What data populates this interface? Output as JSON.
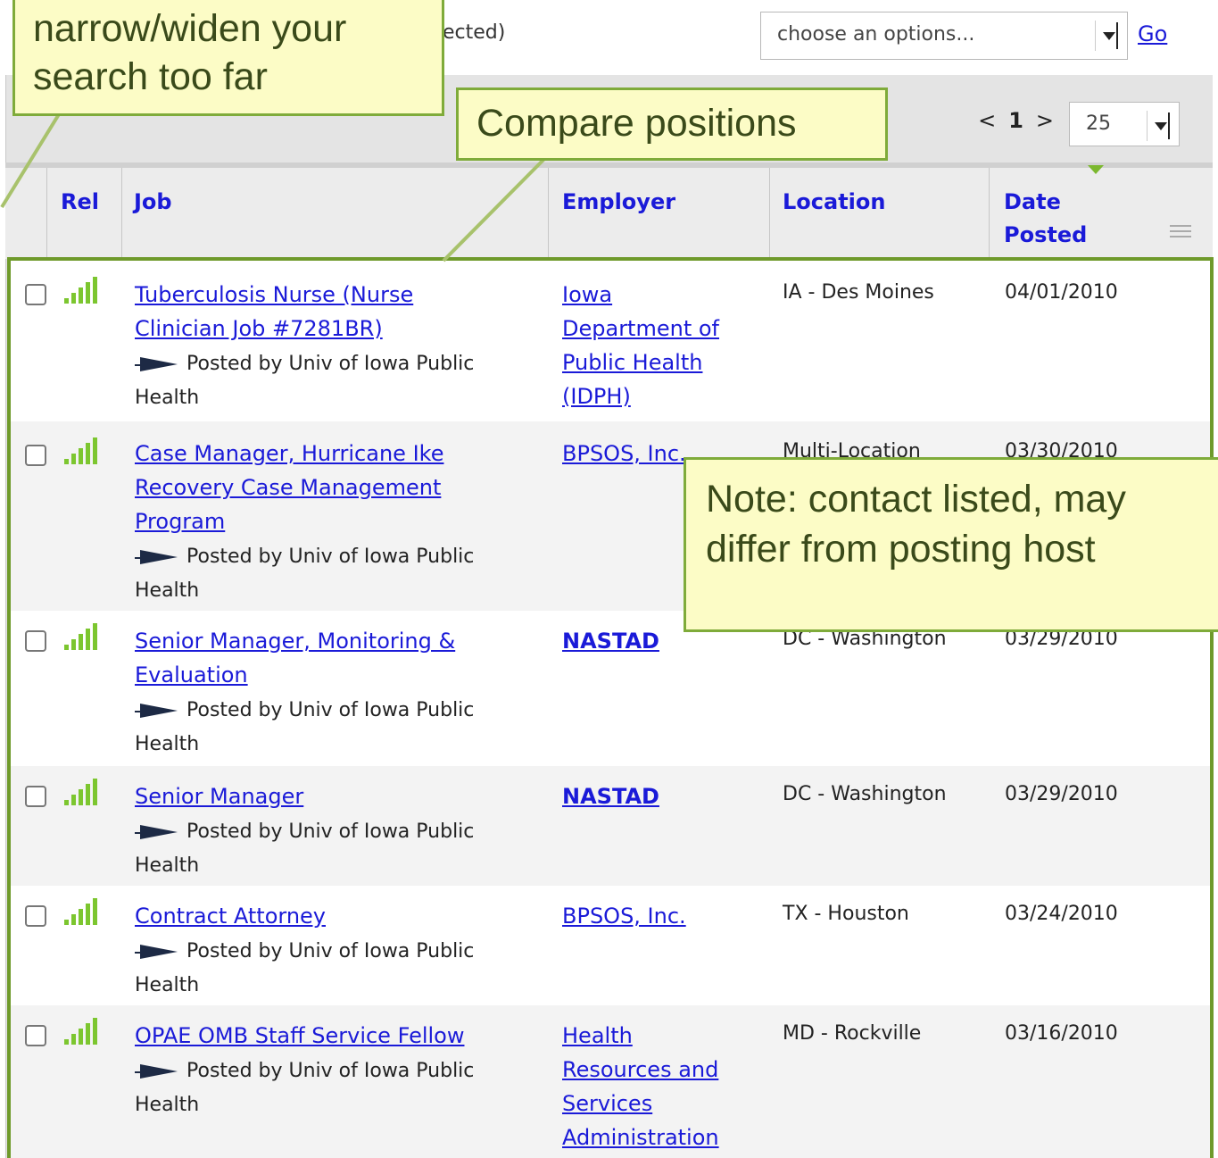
{
  "top": {
    "selected_text": "ected)",
    "action_select_value": "choose an options...",
    "go_label": "Go"
  },
  "pager": {
    "prev": "<",
    "current": "1",
    "next": ">",
    "per_page": "25"
  },
  "columns": {
    "rel": "Rel",
    "job": "Job",
    "employer": "Employer",
    "location": "Location",
    "date_line1": "Date",
    "date_line2": "Posted"
  },
  "rows": [
    {
      "job_lines": [
        "Tuberculosis Nurse (Nurse",
        "Clinician Job #7281BR)"
      ],
      "posted_by": "Posted by Univ of Iowa Public",
      "posted_by_cont": "Health",
      "employer_lines": [
        "Iowa",
        "Department of",
        "Public Health",
        "(IDPH)"
      ],
      "location": "IA - Des Moines",
      "date": "04/01/2010"
    },
    {
      "job_lines": [
        "Case Manager, Hurricane Ike",
        "Recovery Case Management",
        "Program"
      ],
      "posted_by": "Posted by Univ of Iowa Public",
      "posted_by_cont": "Health",
      "employer_lines": [
        "BPSOS, Inc."
      ],
      "location": "Multi-Location",
      "date": "03/30/2010"
    },
    {
      "job_lines": [
        "Senior Manager, Monitoring &",
        "Evaluation"
      ],
      "posted_by": "Posted by Univ of Iowa Public",
      "posted_by_cont": "Health",
      "employer_lines": [
        "NASTAD"
      ],
      "location": "DC - Washington",
      "date": "03/29/2010"
    },
    {
      "job_lines": [
        "Senior Manager"
      ],
      "posted_by": "Posted by Univ of Iowa Public",
      "posted_by_cont": "Health",
      "employer_lines": [
        "NASTAD"
      ],
      "location": "DC - Washington",
      "date": "03/29/2010"
    },
    {
      "job_lines": [
        "Contract Attorney"
      ],
      "posted_by": "Posted by Univ of Iowa Public",
      "posted_by_cont": "Health",
      "employer_lines": [
        "BPSOS, Inc."
      ],
      "location": "TX - Houston",
      "date": "03/24/2010"
    },
    {
      "job_lines": [
        "OPAE OMB Staff Service Fellow"
      ],
      "posted_by": "Posted by Univ of Iowa Public",
      "posted_by_cont": "Health",
      "employer_lines": [
        "Health",
        "Resources and",
        "Services",
        "Administration"
      ],
      "location": "MD - Rockville",
      "date": "03/16/2010"
    }
  ],
  "callouts": {
    "narrow_line1": "narrow/widen your",
    "narrow_line2": "search too far",
    "compare": "Compare positions",
    "note_line1": "Note: contact listed, may",
    "note_line2": "differ from posting host"
  },
  "colors": {
    "link": "#1a1ad8",
    "callout_bg": "#fcfcc6",
    "callout_border": "#7fab3a",
    "highlight_border": "#6f9a2b",
    "relevance_bar": "#7cc62f"
  },
  "icons": {
    "relevance": "signal-bars-icon",
    "posted_by": "pennant-icon"
  }
}
